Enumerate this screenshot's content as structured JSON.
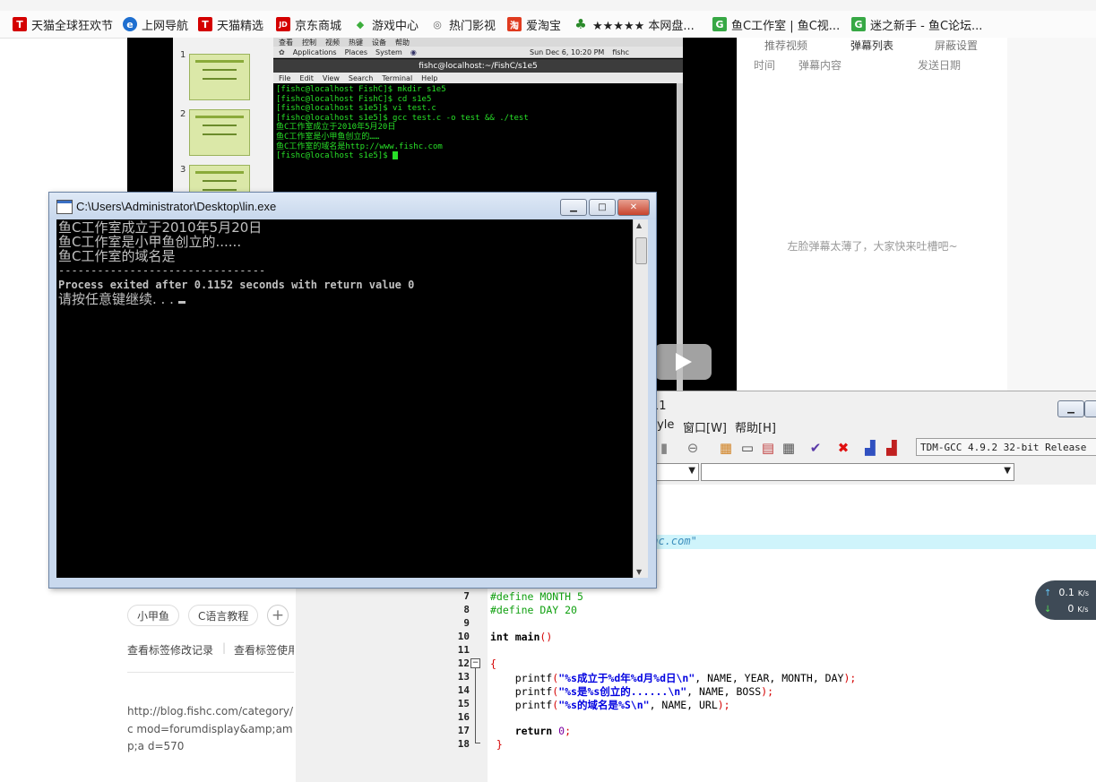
{
  "bookmarks": [
    {
      "label": "天猫全球狂欢节",
      "icon": "tmall-icon",
      "icon_text": "T",
      "color": "#d40000"
    },
    {
      "label": "上网导航",
      "icon": "ie-icon",
      "icon_text": "e",
      "color": "#1e6fd0"
    },
    {
      "label": "天猫精选",
      "icon": "tmall-icon",
      "icon_text": "T",
      "color": "#d40000"
    },
    {
      "label": "京东商城",
      "icon": "jd-icon",
      "icon_text": "JD",
      "color": "#d40000"
    },
    {
      "label": "游戏中心",
      "icon": "gamepad-icon",
      "icon_text": "◆",
      "color": "#3cae3c"
    },
    {
      "label": "热门影视",
      "icon": "globe-icon",
      "icon_text": "◎",
      "color": "#666666"
    },
    {
      "label": "爱淘宝",
      "icon": "taobao-icon",
      "icon_text": "淘",
      "color": "#e03b1f"
    },
    {
      "label": "★★★★★ 本网盘...",
      "icon": "tree-icon",
      "icon_text": "♣",
      "color": "#2a8a2a"
    },
    {
      "label": "鱼C工作室 | 鱼C视...",
      "icon": "fishc-icon",
      "icon_text": "G",
      "color": "#37a845"
    },
    {
      "label": "迷之新手 - 鱼C论坛...",
      "icon": "fishc-icon",
      "icon_text": "G",
      "color": "#37a845"
    }
  ],
  "vm": {
    "menu": [
      "查看",
      "控制",
      "视频",
      "热键",
      "设备",
      "帮助"
    ],
    "panel_items": [
      "Applications",
      "Places",
      "System"
    ],
    "clock": "Sun Dec  6, 10:20 PM",
    "user": "fishc",
    "terminal_title": "fishc@localhost:~/FishC/s1e5",
    "terminal_menu": [
      "File",
      "Edit",
      "View",
      "Search",
      "Terminal",
      "Help"
    ],
    "terminal_lines": [
      "[fishc@localhost FishC]$ mkdir s1e5",
      "[fishc@localhost FishC]$ cd s1e5",
      "[fishc@localhost s1e5]$ vi test.c",
      "[fishc@localhost s1e5]$ gcc test.c -o test && ./test",
      "鱼C工作室成立于2010年5月20日",
      "鱼C工作室是小甲鱼创立的……",
      "鱼C工作室的域名是http://www.fishc.com"
    ],
    "prompt": "[fishc@localhost s1e5]$ "
  },
  "slides": {
    "numbers": [
      "1",
      "2",
      "3"
    ]
  },
  "danmaku": {
    "tabs": [
      "推荐视频",
      "弹幕列表",
      "屏蔽设置"
    ],
    "headers": [
      "时间",
      "弹幕内容",
      "发送日期"
    ],
    "empty_text": "左脸弹幕太薄了，大家快来吐槽吧~"
  },
  "console": {
    "title": "C:\\Users\\Administrator\\Desktop\\lin.exe",
    "lines_cn": [
      "鱼C工作室成立于2010年5月20日",
      "鱼C工作室是小甲鱼创立的......",
      "鱼C工作室的域名是"
    ],
    "separator": "--------------------------------",
    "exit_line": "Process exited after 0.1152 seconds with return value 0",
    "press_key": "请按任意键继续. . . ",
    "btn_min": "▁",
    "btn_max": "□",
    "btn_close": "✕"
  },
  "devcpp": {
    "title_fragment": "11",
    "menu": [
      "tyle",
      "窗口[W]",
      "帮助[H]"
    ],
    "compiler": "TDM-GCC 4.9.2 32-bit Release",
    "string_fragment": "shc.com\"",
    "line_numbers": [
      "7",
      "8",
      "9",
      "10",
      "11",
      "12",
      "13",
      "14",
      "15",
      "16",
      "17",
      "18"
    ],
    "code": {
      "l7": {
        "pre": "#define",
        "name": " MONTH ",
        "num": "5"
      },
      "l8": {
        "pre": "#define",
        "name": " DAY ",
        "num": "20"
      },
      "l10": {
        "kw": "int",
        "rest": " main",
        "punc": "()"
      },
      "l12": "{",
      "l13": {
        "fn": "    printf",
        "p1": "(",
        "str": "\"%s成立于%d年%d月%d日\\n\"",
        "args": ", NAME, YEAR, MONTH, DAY",
        "p2": ");"
      },
      "l14": {
        "fn": "    printf",
        "p1": "(",
        "str": "\"%s是%s创立的......\\n\"",
        "args": ", NAME, BOSS",
        "p2": ");"
      },
      "l15": {
        "fn": "    printf",
        "p1": "(",
        "str": "\"%s的域名是%S\\n\"",
        "args": ", NAME, URL",
        "p2": ");"
      },
      "l17": {
        "kw": "    return",
        "num": " 0",
        "punc": ";"
      },
      "l18": " }"
    }
  },
  "network": {
    "up": "0.1",
    "down": "0",
    "unit": "K/s"
  },
  "page": {
    "tags": [
      "小甲鱼",
      "C语言教程"
    ],
    "links": [
      "查看标签修改记录",
      "查看标签使用"
    ],
    "url_text": "http://blog.fishc.com/category/c mod=forumdisplay&amp;amp;a d=570"
  }
}
